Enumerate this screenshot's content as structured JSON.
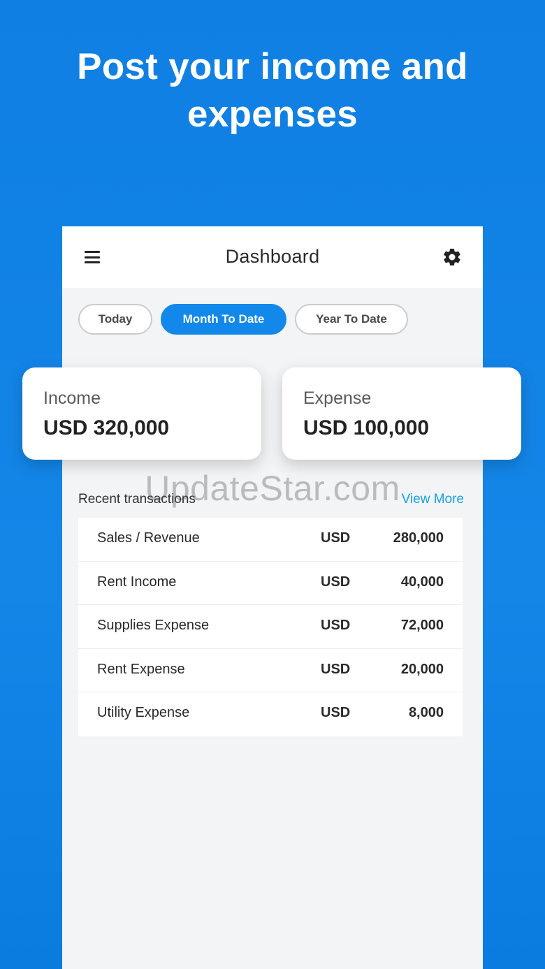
{
  "headline": {
    "line1": "Post your income and",
    "line2": "expenses"
  },
  "appbar": {
    "menu_icon": "hamburger-menu-icon",
    "title": "Dashboard",
    "settings_icon": "gear-icon"
  },
  "filters": {
    "options": [
      "Today",
      "Month To Date",
      "Year To Date"
    ],
    "selected": "Month To Date"
  },
  "summary": {
    "income": {
      "label": "Income",
      "value": "USD 320,000"
    },
    "expense": {
      "label": "Expense",
      "value": "USD 100,000"
    }
  },
  "transactions": {
    "title": "Recent transactions",
    "view_more": "View More",
    "rows": [
      {
        "name": "Sales / Revenue",
        "currency": "USD",
        "amount": "280,000"
      },
      {
        "name": "Rent Income",
        "currency": "USD",
        "amount": "40,000"
      },
      {
        "name": "Supplies Expense",
        "currency": "USD",
        "amount": "72,000"
      },
      {
        "name": "Rent Expense",
        "currency": "USD",
        "amount": "20,000"
      },
      {
        "name": "Utility Expense",
        "currency": "USD",
        "amount": "8,000"
      }
    ]
  },
  "watermark": "UpdateStar.com",
  "colors": {
    "background": "#1486e8",
    "accent": "#1289ea",
    "link": "#17a0e8"
  }
}
